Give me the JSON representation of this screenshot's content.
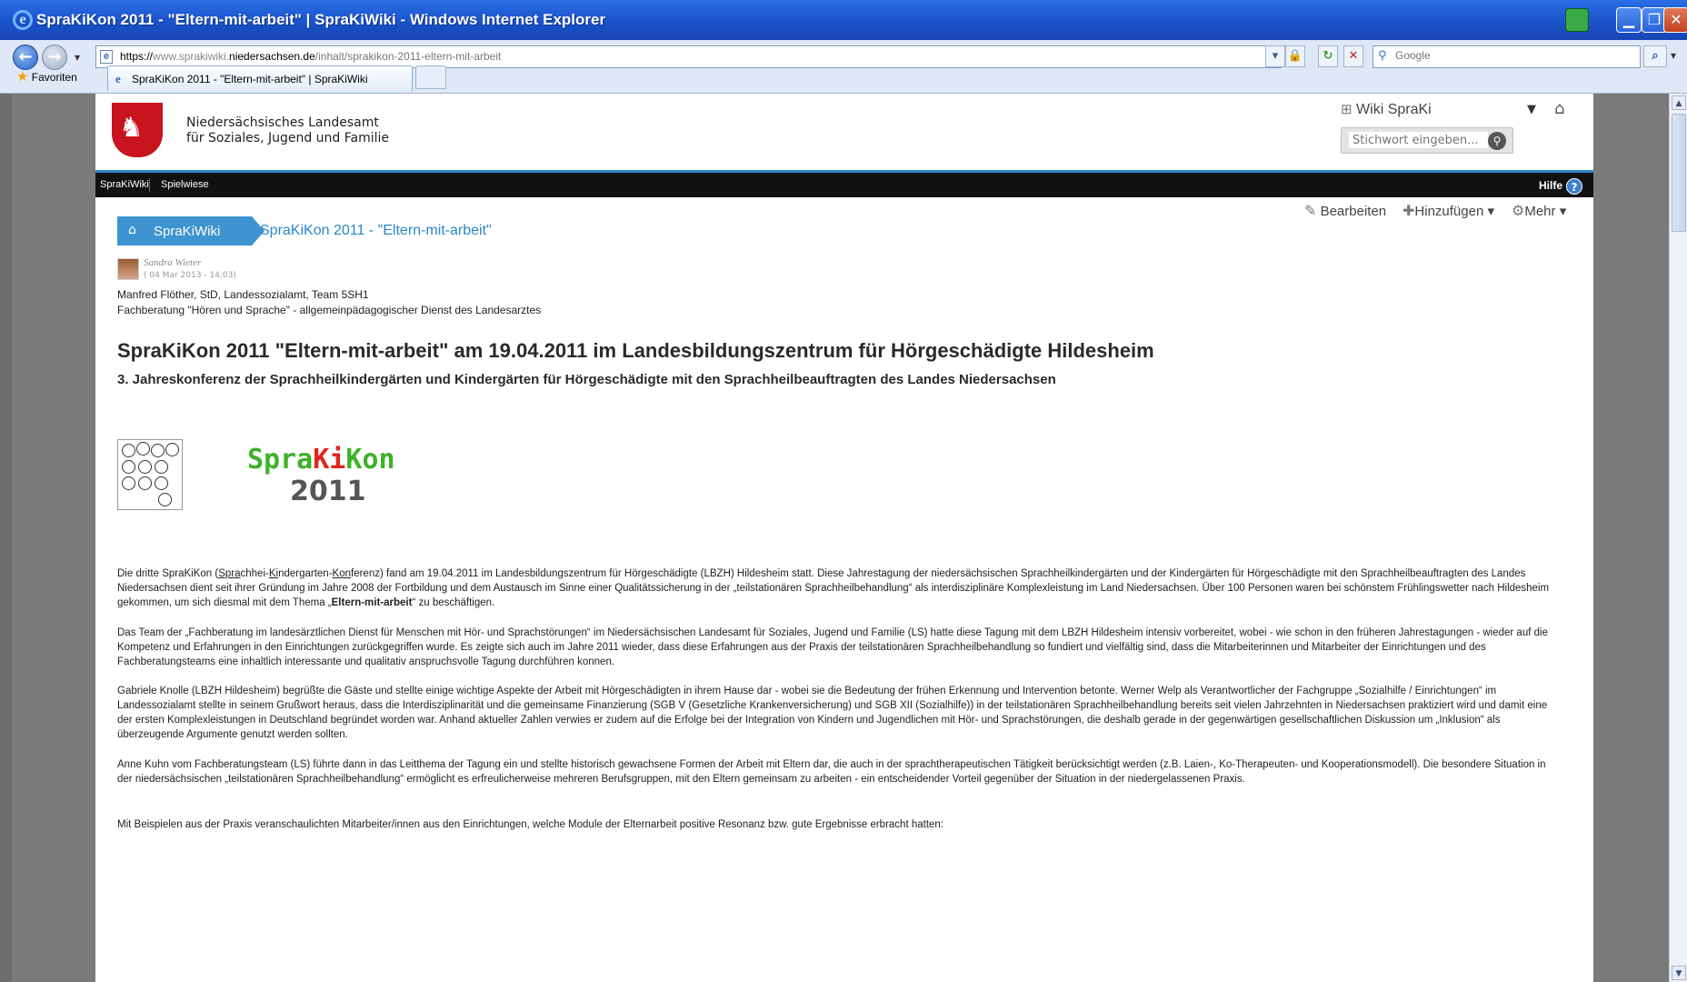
{
  "window": {
    "title": "SpraKiKon 2011 - \"Eltern-mit-arbeit\" | SpraKiWiki - Windows Internet Explorer"
  },
  "address": {
    "url_scheme": "https://",
    "url_sub": "www.sprakiwiki.",
    "url_domain": "niedersachsen.de",
    "url_path": "/inhalt/sprakikon-2011-eltern-mit-arbeit",
    "search_placeholder": "Google"
  },
  "favorites": {
    "label": "Favoriten"
  },
  "tab": {
    "label": "SpraKiKon 2011 - \"Eltern-mit-arbeit\" | SpraKiWiki"
  },
  "header": {
    "org_line1": "Niedersächsisches Landesamt",
    "org_line2": "für Soziales, Jugend und Familie",
    "wiki_name": "Wiki SpraKi",
    "search_placeholder": "Stichwort eingeben..."
  },
  "nav": {
    "items": [
      "SpraKiWiki",
      "Spielwiese"
    ],
    "help": "Hilfe"
  },
  "actions": {
    "edit": "Bearbeiten",
    "add": "Hinzufügen",
    "more": "Mehr"
  },
  "breadcrumb": {
    "home": "SpraKiWiki",
    "current": "SpraKiKon 2011 - \"Eltern-mit-arbeit\""
  },
  "author": {
    "name": "Sandra Wieter",
    "date": "( 04 Mar 2013 - 14:03)"
  },
  "meta": {
    "line1": "Manfred Flöther, StD, Landessozialamt, Team 5SH1",
    "line2": "Fachberatung \"Hören und Sprache\" - allgemeinpädagogischer Dienst des Landesarztes"
  },
  "article": {
    "title": "SpraKiKon 2011 \"Eltern-mit-arbeit\" am 19.04.2011 im Landesbildungszentrum für Hörgeschädigte Hildesheim",
    "subtitle": "3. Jahreskonferenz der Sprachheilkindergärten und Kindergärten für Hörgeschädigte mit den Sprachheilbeauftragten des Landes Niedersachsen",
    "logo_text_1": "Spra",
    "logo_text_2": "Ki",
    "logo_text_3": "Kon",
    "logo_year": "2011",
    "p1_a": "Die dritte SpraKiKon (",
    "p1_u1": "Spra",
    "p1_b": "chhei-",
    "p1_u2": "Ki",
    "p1_c": "ndergarten-",
    "p1_u3": "Kon",
    "p1_d": "ferenz) fand am 19.04.2011 im Landesbildungszentrum für Hörgeschädigte (LBZH) Hildesheim statt. Diese Jahrestagung der niedersächsischen Sprachheilkindergärten und der Kindergärten für Hörgeschädigte mit den Sprachheilbeauftragten des Landes Niedersachsen dient seit ihrer Gründung im Jahre 2008 der Fortbildung und dem Austausch im Sinne einer Qualitätssicherung in der „teilstationären Sprachheilbehandlung“ als interdisziplinäre Komplexleistung im Land Niedersachsen. Über 100 Personen waren bei schönstem Frühlingswetter nach Hildesheim gekommen, um sich diesmal mit dem Thema „",
    "p1_bold": "Eltern-mit-arbeit",
    "p1_e": "“ zu beschäftigen.",
    "p2": "Das Team der „Fachberatung im landesärztlichen Dienst für Menschen mit Hör- und Sprachstörungen“ im Niedersächsischen Landesamt für Soziales, Jugend und Familie (LS) hatte diese Tagung mit dem LBZH Hildesheim intensiv vorbereitet, wobei - wie schon in den früheren Jahrestagungen - wieder auf die Kompetenz und Erfahrungen in den Einrichtungen zurückgegriffen wurde. Es zeigte sich auch im Jahre 2011 wieder, dass diese Erfahrungen aus der Praxis der teilstationären Sprachheilbehandlung so fundiert und vielfältig sind, dass die Mitarbeiterinnen und Mitarbeiter der Einrichtungen und des Fachberatungsteams eine inhaltlich interessante und qualitativ anspruchsvolle Tagung durchführen konnen.",
    "p3": "Gabriele Knolle (LBZH Hildesheim) begrüßte die Gäste und stellte einige wichtige Aspekte der Arbeit mit Hörgeschädigten in ihrem Hause dar - wobei sie die Bedeutung der frühen Erkennung und Intervention betonte. Werner Welp als Verantwortlicher der Fachgruppe „Sozialhilfe / Einrichtungen“ im Landessozialamt stellte in seinem Grußwort heraus, dass die Interdisziplinarität und die gemeinsame Finanzierung (SGB V (Gesetzliche Krankenversicherung) und SGB XII (Sozialhilfe)) in der teilstationären Sprachheilbehandlung bereits seit vielen Jahrzehnten in Niedersachsen praktiziert wird und damit eine der ersten Komplexleistungen in Deutschland begründet worden war. Anhand aktueller Zahlen verwies er zudem auf die Erfolge bei der Integration von Kindern und Jugendlichen mit Hör- und Sprachstörungen, die deshalb gerade in der gegenwärtigen gesellschaftlichen Diskussion um „Inklusion“ als überzeugende Argumente genutzt werden sollten.",
    "p4": "Anne Kuhn vom Fachberatungsteam (LS) führte dann in das Leitthema der Tagung ein und stellte historisch gewachsene Formen der Arbeit mit Eltern dar, die auch in der sprachtherapeutischen Tätigkeit berücksichtigt werden (z.B. Laien-, Ko-Therapeuten- und Kooperationsmodell). Die besondere Situation in der niedersächsischen „teilstationären Sprachheilbehandlung“ ermöglicht es erfreulicherweise mehreren Berufsgruppen, mit den Eltern gemeinsam zu arbeiten - ein entscheidender Vorteil gegenüber der Situation in der niedergelassenen Praxis.",
    "p5": "Mit Beispielen aus der Praxis veranschaulichten Mitarbeiter/innen aus den Einrichtungen, welche Module der Elternarbeit positive Resonanz bzw. gute Ergebnisse erbracht hatten:"
  }
}
